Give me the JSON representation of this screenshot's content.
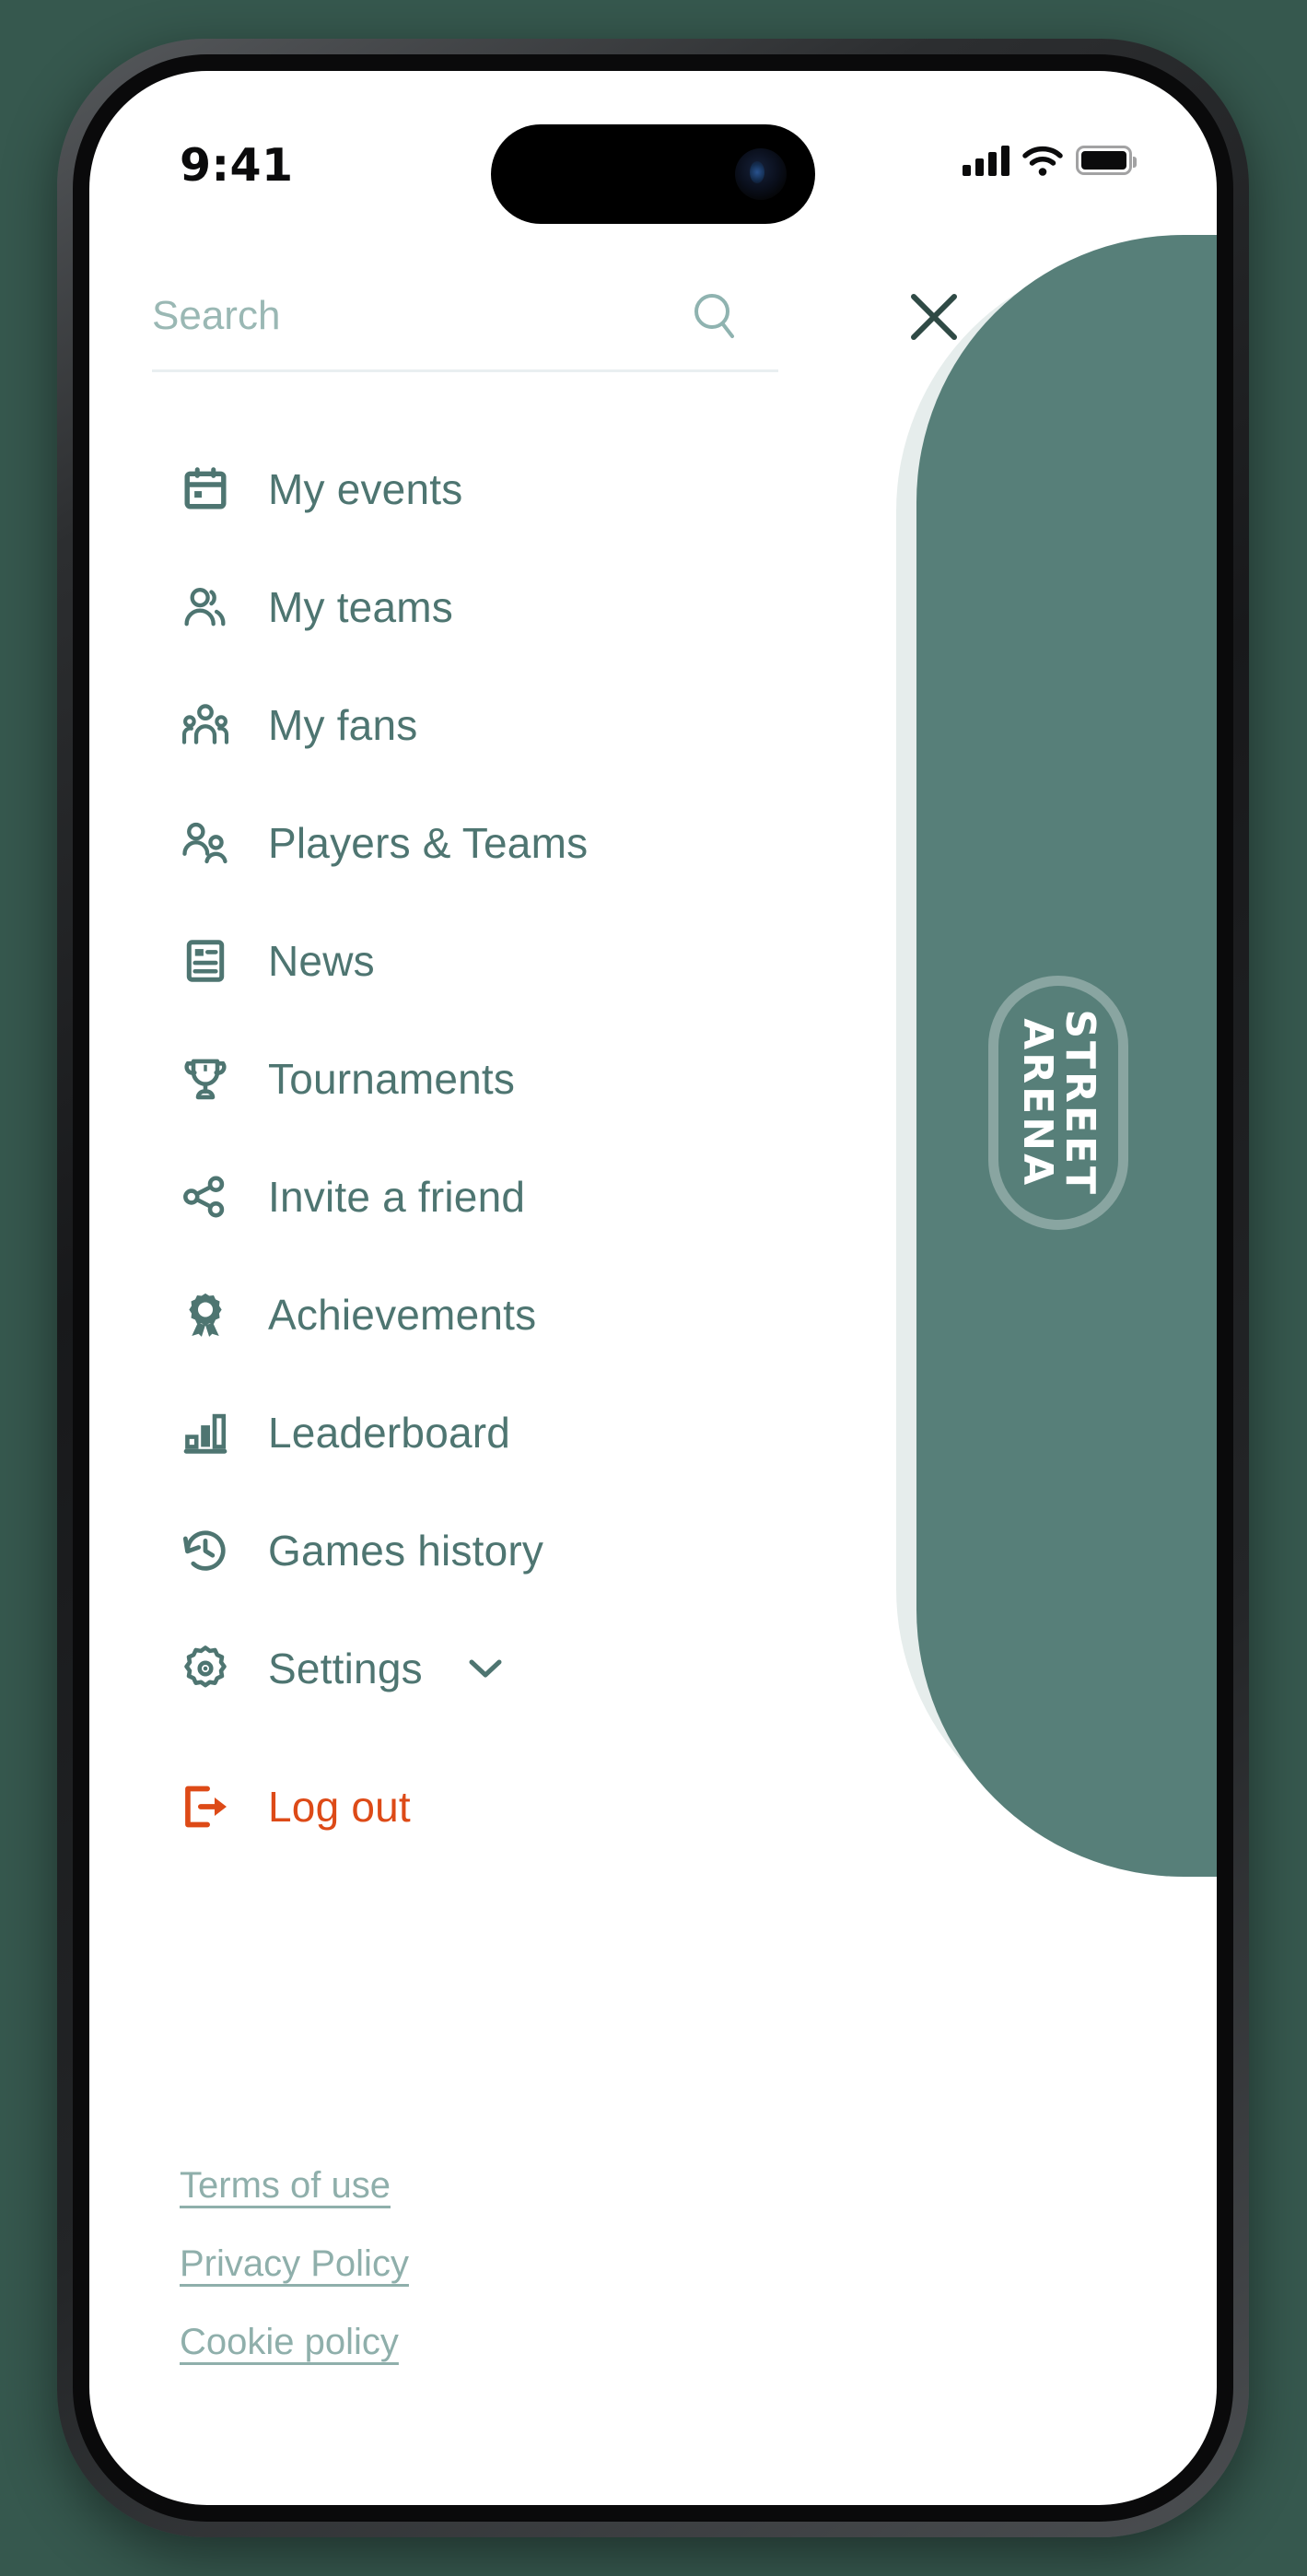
{
  "status_bar": {
    "time": "9:41",
    "signal_icon": "cellular-bars-icon",
    "wifi_icon": "wifi-icon",
    "battery_icon": "battery-full-icon"
  },
  "search": {
    "placeholder": "Search",
    "value": "",
    "search_icon": "search-icon",
    "close_icon": "close-icon"
  },
  "brand": {
    "line1": "STREET",
    "line2": "ARENA",
    "panel_color": "#577f79",
    "panel_shadow_color": "#e6edec"
  },
  "menu": {
    "items": [
      {
        "id": "my-events",
        "label": "My events",
        "icon": "calendar-icon"
      },
      {
        "id": "my-teams",
        "label": "My teams",
        "icon": "users-two-icon"
      },
      {
        "id": "my-fans",
        "label": "My fans",
        "icon": "users-three-icon"
      },
      {
        "id": "players-teams",
        "label": "Players & Teams",
        "icon": "user-pair-icon"
      },
      {
        "id": "news",
        "label": "News",
        "icon": "article-icon"
      },
      {
        "id": "tournaments",
        "label": "Tournaments",
        "icon": "trophy-icon"
      },
      {
        "id": "invite-a-friend",
        "label": "Invite a friend",
        "icon": "share-icon"
      },
      {
        "id": "achievements",
        "label": "Achievements",
        "icon": "medal-icon"
      },
      {
        "id": "leaderboard",
        "label": "Leaderboard",
        "icon": "bar-chart-icon"
      },
      {
        "id": "games-history",
        "label": "Games history",
        "icon": "clock-rewind-icon"
      },
      {
        "id": "settings",
        "label": "Settings",
        "icon": "gear-icon",
        "expandable": true,
        "chevron_icon": "chevron-down-icon"
      }
    ],
    "label_color": "#4e7571"
  },
  "logout": {
    "label": "Log out",
    "icon": "sign-out-icon",
    "color": "#dd4a17"
  },
  "footer": {
    "links": [
      {
        "id": "terms-of-use",
        "label": "Terms of use"
      },
      {
        "id": "privacy-policy",
        "label": "Privacy Policy"
      },
      {
        "id": "cookie-policy",
        "label": "Cookie policy"
      }
    ],
    "link_color": "#8fafab"
  }
}
